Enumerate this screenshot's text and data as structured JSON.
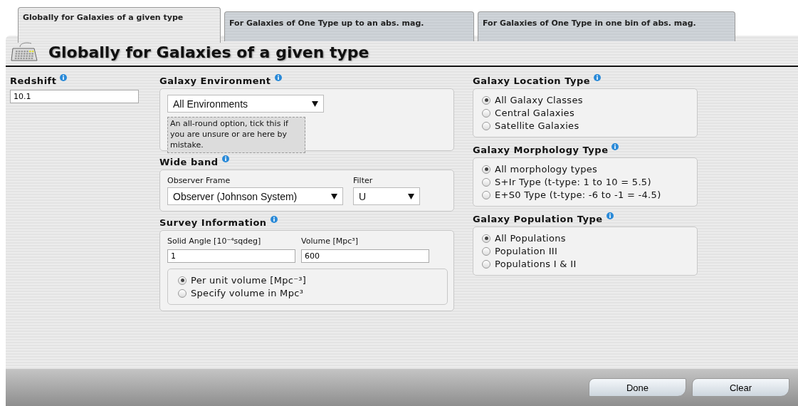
{
  "tabs": [
    {
      "label": "Globally for Galaxies of a given type",
      "selected": true
    },
    {
      "label": "For Galaxies of One Type up to an abs. mag.",
      "selected": false
    },
    {
      "label": "For Galaxies of One Type in one bin of abs. mag.",
      "selected": false
    }
  ],
  "panel": {
    "title": "Globally for Galaxies of a given type"
  },
  "redshift": {
    "label": "Redshift",
    "value": "10.1"
  },
  "environment": {
    "title": "Galaxy Environment",
    "select": "All Environments",
    "hint": "An all-round option, tick this if you are unsure or are here by mistake."
  },
  "wide_band": {
    "title": "Wide band",
    "frame_label": "Observer Frame",
    "frame_value": "Observer (Johnson System)",
    "filter_label": "Filter",
    "filter_value": "U"
  },
  "survey": {
    "title": "Survey Information",
    "angle_label": "Solid Angle [10⁻⁴sqdeg]",
    "angle_value": "1",
    "volume_label": "Volume [Mpc³]",
    "volume_value": "600",
    "options": [
      {
        "label": "Per unit volume [Mpc⁻³]",
        "selected": true
      },
      {
        "label": "Specify volume in Mpc³",
        "selected": false
      }
    ]
  },
  "groups": [
    {
      "title": "Galaxy Location Type",
      "options": [
        {
          "label": "All Galaxy Classes",
          "selected": true
        },
        {
          "label": "Central Galaxies",
          "selected": false
        },
        {
          "label": "Satellite Galaxies",
          "selected": false
        }
      ]
    },
    {
      "title": "Galaxy Morphology Type",
      "options": [
        {
          "label": "All morphology types",
          "selected": true
        },
        {
          "label": "S+Ir Type (t-type: 1 to 10 = 5.5)",
          "selected": false
        },
        {
          "label": "E+S0 Type (t-type: -6 to -1 = -4.5)",
          "selected": false
        }
      ]
    },
    {
      "title": "Galaxy Population Type",
      "options": [
        {
          "label": "All Populations",
          "selected": true
        },
        {
          "label": "Population III",
          "selected": false
        },
        {
          "label": "Populations I & II",
          "selected": false
        }
      ]
    }
  ],
  "buttons": [
    "Done",
    "Clear"
  ]
}
